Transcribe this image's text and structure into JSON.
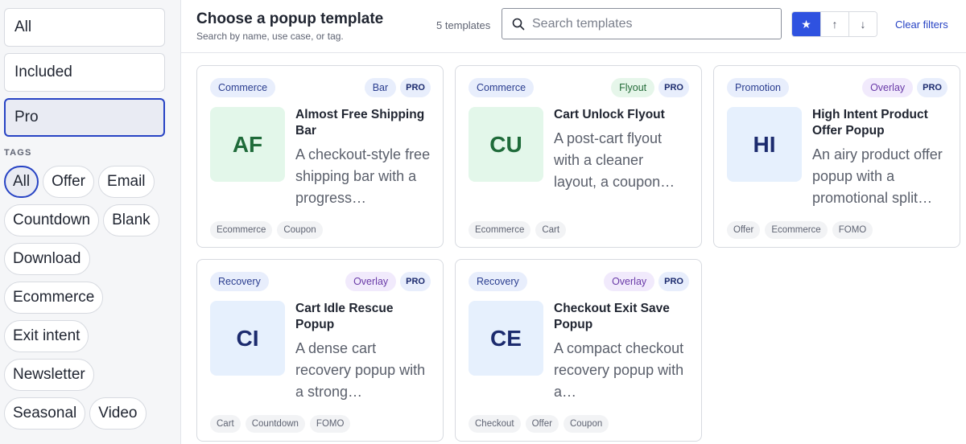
{
  "sidebar": {
    "filters": [
      {
        "label": "All",
        "active": false
      },
      {
        "label": "Included",
        "active": false
      },
      {
        "label": "Pro",
        "active": true
      }
    ],
    "tags_heading": "TAGS",
    "tags": [
      {
        "label": "All",
        "active": true
      },
      {
        "label": "Offer",
        "active": false
      },
      {
        "label": "Email",
        "active": false
      },
      {
        "label": "Countdown",
        "active": false
      },
      {
        "label": "Blank",
        "active": false
      },
      {
        "label": "Download",
        "active": false
      },
      {
        "label": "Ecommerce",
        "active": false
      },
      {
        "label": "Exit intent",
        "active": false
      },
      {
        "label": "Newsletter",
        "active": false
      },
      {
        "label": "Seasonal",
        "active": false
      },
      {
        "label": "Video",
        "active": false
      }
    ]
  },
  "header": {
    "title": "Choose a popup template",
    "subtitle": "Search by name, use case, or tag.",
    "count": "5 templates",
    "search_placeholder": "Search templates",
    "sort": [
      {
        "icon": "star-icon",
        "glyph": "★",
        "active": true
      },
      {
        "icon": "arrow-up-icon",
        "glyph": "↑",
        "active": false
      },
      {
        "icon": "arrow-down-icon",
        "glyph": "↓",
        "active": false
      }
    ],
    "clear_label": "Clear filters"
  },
  "cards": [
    {
      "category": "Commerce",
      "type": "Bar",
      "type_style": "bar",
      "pro": "PRO",
      "initials": "AF",
      "thumb_color": "green",
      "title": "Almost Free Shipping Bar",
      "description": "A checkout-style free shipping bar with a progress…",
      "tags": [
        "Ecommerce",
        "Coupon"
      ]
    },
    {
      "category": "Commerce",
      "type": "Flyout",
      "type_style": "flyout",
      "pro": "PRO",
      "initials": "CU",
      "thumb_color": "green",
      "title": "Cart Unlock Flyout",
      "description": "A post-cart flyout with a cleaner layout, a coupon…",
      "tags": [
        "Ecommerce",
        "Cart"
      ]
    },
    {
      "category": "Promotion",
      "type": "Overlay",
      "type_style": "overlay",
      "pro": "PRO",
      "initials": "HI",
      "thumb_color": "blue",
      "title": "High Intent Product Offer Popup",
      "description": "An airy product offer popup with a promotional split…",
      "tags": [
        "Offer",
        "Ecommerce",
        "FOMO"
      ]
    },
    {
      "category": "Recovery",
      "type": "Overlay",
      "type_style": "overlay",
      "pro": "PRO",
      "initials": "CI",
      "thumb_color": "blue",
      "title": "Cart Idle Rescue Popup",
      "description": "A dense cart recovery popup with a strong…",
      "tags": [
        "Cart",
        "Countdown",
        "FOMO"
      ]
    },
    {
      "category": "Recovery",
      "type": "Overlay",
      "type_style": "overlay",
      "pro": "PRO",
      "initials": "CE",
      "thumb_color": "blue",
      "title": "Checkout Exit Save Popup",
      "description": "A compact checkout recovery popup with a…",
      "tags": [
        "Checkout",
        "Offer",
        "Coupon"
      ]
    }
  ]
}
